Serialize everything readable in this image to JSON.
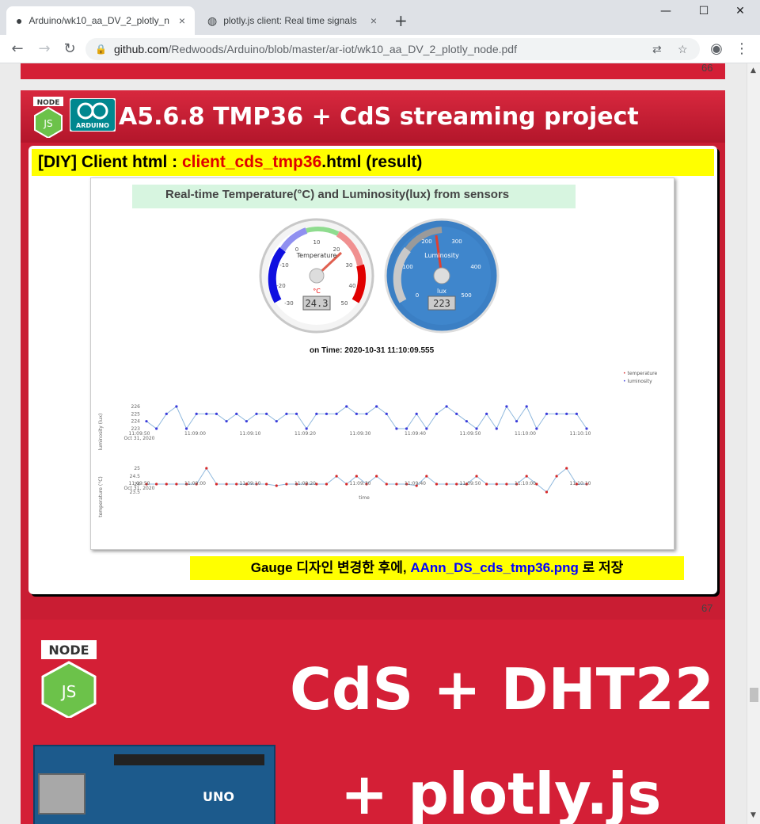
{
  "browser": {
    "tabs": [
      {
        "title": "Arduino/wk10_aa_DV_2_plotly_n"
      },
      {
        "title": "plotly.js client: Real time signals"
      }
    ],
    "url_host": "github.com",
    "url_path": "/Redwoods/Arduino/blob/master/ar-iot/wk10_aa_DV_2_plotly_node.pdf"
  },
  "page_numbers": {
    "prev": "66",
    "current": "67"
  },
  "slide": {
    "title": "A5.6.8 TMP36 + CdS streaming project",
    "node_logo": "NODE",
    "arduino_logo": "ARDUINO",
    "diy_prefix": "[DIY] Client html : ",
    "diy_file": "client_cds_tmp36",
    "diy_suffix": ".html (result)",
    "note_prefix": "Gauge 디자인 변경한 후에, ",
    "note_file": "AAnn_DS_cds_tmp36.png",
    "note_suffix": " 로 저장"
  },
  "screenshot": {
    "heading": "Real-time Temperature(°C) and Luminosity(lux) from sensors",
    "timestamp": "on Time: 2020-10-31 11:10:09.555",
    "gauge_temp": {
      "label": "Temperature",
      "unit": "°C",
      "value": "24.3",
      "ticks": [
        "-30",
        "-20",
        "-10",
        "0",
        "10",
        "20",
        "30",
        "40",
        "50"
      ]
    },
    "gauge_lux": {
      "label": "Luminosity",
      "unit": "lux",
      "value": "223",
      "ticks": [
        "0",
        "100",
        "200",
        "300",
        "400",
        "500"
      ]
    },
    "x_ticks": [
      "11:09:50",
      "11:09:00",
      "11:09:10",
      "11:09:20",
      "11:09:30",
      "11:09:40",
      "11:09:50",
      "11:10:00",
      "11:10:10"
    ],
    "x_date": "Oct 31, 2020",
    "xlabel": "time",
    "legend": [
      "temperature",
      "luminosity"
    ],
    "lux_ylabel": "luminosity (lux)",
    "lux_yticks": [
      "226",
      "225",
      "224",
      "223"
    ],
    "temp_ylabel": "temperature (°C)",
    "temp_yticks": [
      "25",
      "24.5",
      "24",
      "23.5"
    ]
  },
  "chart_data": [
    {
      "type": "line",
      "name": "luminosity",
      "ylim": [
        223,
        226
      ],
      "values": [
        224,
        223,
        225,
        226,
        223,
        225,
        225,
        225,
        224,
        225,
        224,
        225,
        225,
        224,
        225,
        225,
        223,
        225,
        225,
        225,
        226,
        225,
        225,
        226,
        225,
        223,
        223,
        225,
        223,
        225,
        226,
        225,
        224,
        223,
        225,
        223,
        226,
        224,
        226,
        223,
        225,
        225,
        225,
        225,
        223
      ]
    },
    {
      "type": "line",
      "name": "temperature",
      "ylim": [
        23.5,
        25
      ],
      "values": [
        24,
        24,
        24,
        24,
        24,
        24,
        25,
        24,
        24,
        24,
        24,
        24,
        24,
        23.9,
        24,
        24,
        24,
        24,
        24,
        24.5,
        24,
        24.5,
        24,
        24.5,
        24,
        24,
        24,
        23.9,
        24.5,
        24,
        24,
        24,
        24,
        24.5,
        24,
        24,
        24,
        24,
        24.5,
        24,
        23.5,
        24.5,
        25,
        24,
        24
      ]
    }
  ],
  "colors": {
    "slide_red": "#d41f36",
    "highlight": "#ffff00",
    "lux_line": "#3b3bdb",
    "temp_line": "#d62728"
  },
  "next_slide": {
    "title_line1": "CdS + DHT22",
    "title_line2": "+ plotly.js",
    "board_text": "UNO"
  }
}
